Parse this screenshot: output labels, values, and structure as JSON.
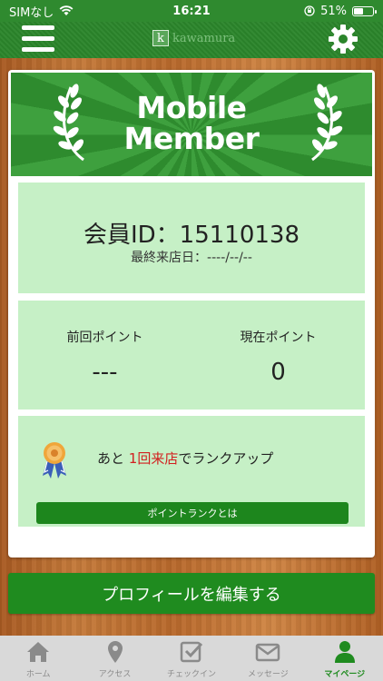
{
  "status_bar": {
    "carrier": "SIMなし",
    "time": "16:21",
    "battery": "51%",
    "battery_level": 0.51
  },
  "header": {
    "logo_letter": "k",
    "logo_text": "kawamura"
  },
  "banner": {
    "title_line1": "Mobile",
    "title_line2": "Member"
  },
  "member": {
    "id_text": "会員ID：15110138",
    "last_visit": "最終来店日：----/--/--"
  },
  "points": {
    "previous_label": "前回ポイント",
    "previous_value": "---",
    "current_label": "現在ポイント",
    "current_value": "0"
  },
  "rank": {
    "text_before": "あと ",
    "text_highlight": "1回来店",
    "text_after": "でランクアップ",
    "button_label": "ポイントランクとは"
  },
  "edit_profile_button": "プロフィールを編集する",
  "tabs": [
    {
      "label": "ホーム",
      "icon": "home-icon"
    },
    {
      "label": "アクセス",
      "icon": "map-pin-icon"
    },
    {
      "label": "チェックイン",
      "icon": "checkin-icon"
    },
    {
      "label": "メッセージ",
      "icon": "envelope-icon"
    },
    {
      "label": "マイページ",
      "icon": "user-icon",
      "active": true
    }
  ],
  "colors": {
    "brand_green": "#2b852b",
    "panel_green": "#c6f0c6",
    "highlight_red": "#d21f1f",
    "tab_inactive": "#8a8a8a"
  }
}
